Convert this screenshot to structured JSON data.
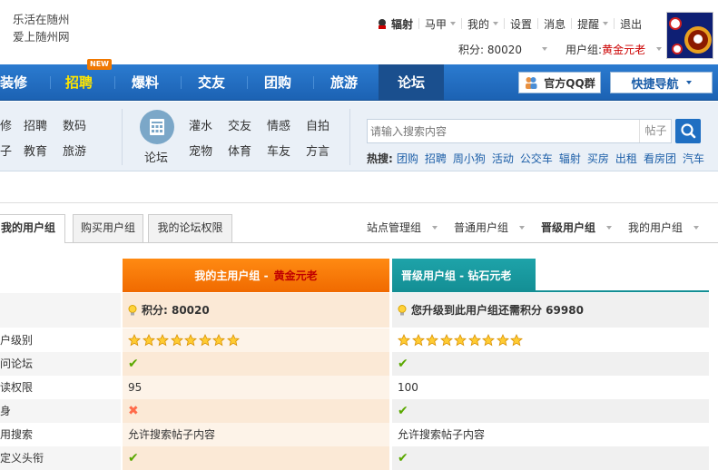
{
  "brand": {
    "line1": "乐活在随州",
    "line2": "爱上随州网"
  },
  "topnav": {
    "user": "辐射",
    "items": [
      "马甲",
      "我的",
      "设置",
      "消息",
      "提醒",
      "退出"
    ]
  },
  "subtop": {
    "points_label": "积分: 80020",
    "group_label": "用户组: ",
    "group_value": "黄金元老"
  },
  "navbar": {
    "items": [
      "装修",
      "招聘",
      "爆料",
      "交友",
      "团购",
      "旅游",
      "论坛"
    ],
    "new_badge": "NEW",
    "qq_btn": "官方QQ群",
    "quick_nav": "快捷导航"
  },
  "subnav": {
    "left_row1": [
      "修",
      "招聘",
      "数码"
    ],
    "left_row2": [
      "子",
      "教育",
      "旅游"
    ],
    "forum_label": "论坛",
    "row1": [
      "灌水",
      "交友",
      "情感",
      "自拍"
    ],
    "row2": [
      "宠物",
      "体育",
      "车友",
      "方言"
    ]
  },
  "search": {
    "placeholder": "请输入搜索内容",
    "type": "帖子"
  },
  "hot": {
    "label": "热搜:",
    "keywords": [
      "团购",
      "招聘",
      "周小狗",
      "活动",
      "公交车",
      "辐射",
      "买房",
      "出租",
      "看房团",
      "汽车"
    ]
  },
  "tabs": [
    "我的用户组",
    "购买用户组",
    "我的论坛权限"
  ],
  "ugnav": [
    "站点管理组",
    "普通用户组",
    "晋级用户组",
    "我的用户组"
  ],
  "compare": {
    "header1": "我的主用户组 - ",
    "header1_value": "黄金元老",
    "header2": "晋级用户组 - 钻石元老",
    "points1": "积分: 80020",
    "points2": "您升级到此用户组还需积分  69980",
    "rows": [
      {
        "label": "户级别",
        "v1": "stars:8",
        "v2": "stars:9"
      },
      {
        "label": "问论坛",
        "v1": "check",
        "v2": "check"
      },
      {
        "label": "读权限",
        "v1": "95",
        "v2": "100"
      },
      {
        "label": "身",
        "v1": "cross",
        "v2": "check"
      },
      {
        "label": "用搜索",
        "v1": "允许搜索帖子内容",
        "v2": "允许搜索帖子内容"
      },
      {
        "label": "定义头衔",
        "v1": "check",
        "v2": "check"
      }
    ]
  },
  "colors": {
    "nav": "#1c62b3",
    "active": "#1a4f8e",
    "orange": "#f07800",
    "teal": "#138e94",
    "link": "#1d5fa8"
  }
}
